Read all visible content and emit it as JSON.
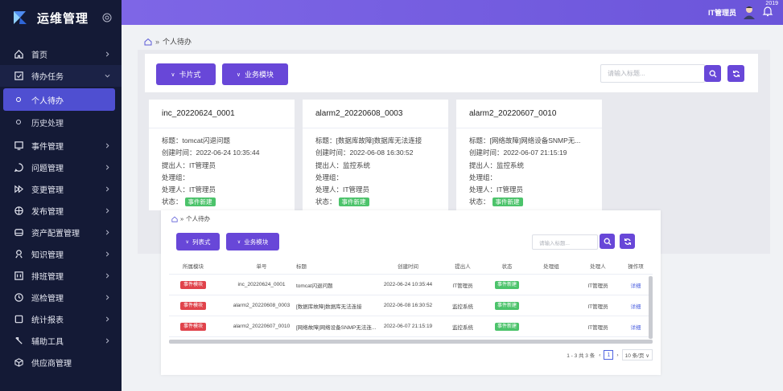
{
  "sidebar": {
    "title": "运维管理",
    "items": [
      {
        "label": "首页"
      },
      {
        "label": "待办任务"
      },
      {
        "label": "事件管理"
      },
      {
        "label": "问题管理"
      },
      {
        "label": "变更管理"
      },
      {
        "label": "发布管理"
      },
      {
        "label": "资产配置管理"
      },
      {
        "label": "知识管理"
      },
      {
        "label": "排班管理"
      },
      {
        "label": "巡检管理"
      },
      {
        "label": "统计报表"
      },
      {
        "label": "辅助工具"
      },
      {
        "label": "供应商管理"
      }
    ],
    "sub_items": [
      {
        "label": "个人待办"
      },
      {
        "label": "历史处理"
      }
    ]
  },
  "topbar": {
    "user": "IT管理员",
    "badge": "2019"
  },
  "breadcrumb": {
    "separator": "»",
    "current": "个人待办"
  },
  "card_view": {
    "card_button": "卡片式",
    "module_button": "业务模块",
    "search_placeholder": "请输入标题...",
    "cards": [
      {
        "id": "inc_20220624_0001",
        "title": "标题：tomcat闪退问题",
        "created": "创建时间：2022-06-24 10:35:44",
        "submitter": "提出人：IT管理员",
        "group": "处理组：",
        "handler": "处理人：IT管理员",
        "status_label": "状态：",
        "status": "事件新建"
      },
      {
        "id": "alarm2_20220608_0003",
        "title": "标题：[数据库故障]数据库无法连接",
        "created": "创建时间：2022-06-08 16:30:52",
        "submitter": "提出人：监控系统",
        "group": "处理组：",
        "handler": "处理人：IT管理员",
        "status_label": "状态：",
        "status": "事件新建"
      },
      {
        "id": "alarm2_20220607_0010",
        "title": "标题：[网络故障]网络设备SNMP无...",
        "created": "创建时间：2022-06-07 21:15:19",
        "submitter": "提出人：监控系统",
        "group": "处理组：",
        "handler": "处理人：IT管理员",
        "status_label": "状态：",
        "status": "事件新建"
      }
    ]
  },
  "list_view": {
    "breadcrumb": "个人待办",
    "list_button": "列表式",
    "module_button": "业务模块",
    "search_placeholder": "请输入标题...",
    "columns": [
      "所属模块",
      "单号",
      "标题",
      "创建时间",
      "提出人",
      "状态",
      "处理组",
      "处理人",
      "操作项"
    ],
    "rows": [
      {
        "module": "事件模块",
        "no": "inc_20220624_0001",
        "title": "tomcat闪退问题",
        "created": "2022-06-24 10:35:44",
        "submitter": "IT管理员",
        "status": "事件新建",
        "group": "",
        "handler": "IT管理员",
        "action": "详细"
      },
      {
        "module": "事件模块",
        "no": "alarm2_20220608_0003",
        "title": "[数据库故障]数据库无法连接",
        "created": "2022-06-08 16:30:52",
        "submitter": "监控系统",
        "status": "事件新建",
        "group": "",
        "handler": "IT管理员",
        "action": "详细"
      },
      {
        "module": "事件模块",
        "no": "alarm2_20220607_0010",
        "title": "[网络故障]网络设备SNMP无法连...",
        "created": "2022-06-07 21:15:19",
        "submitter": "监控系统",
        "status": "事件新建",
        "group": "",
        "handler": "IT管理员",
        "action": "详细"
      }
    ],
    "pager": {
      "total": "1 - 3 共 3 条",
      "page": "1",
      "size": "10 条/页"
    }
  },
  "colors": {
    "sidebar_bg": "#141a36",
    "accent": "#6847d8",
    "success": "#4cc36b",
    "danger": "#e0434b"
  }
}
